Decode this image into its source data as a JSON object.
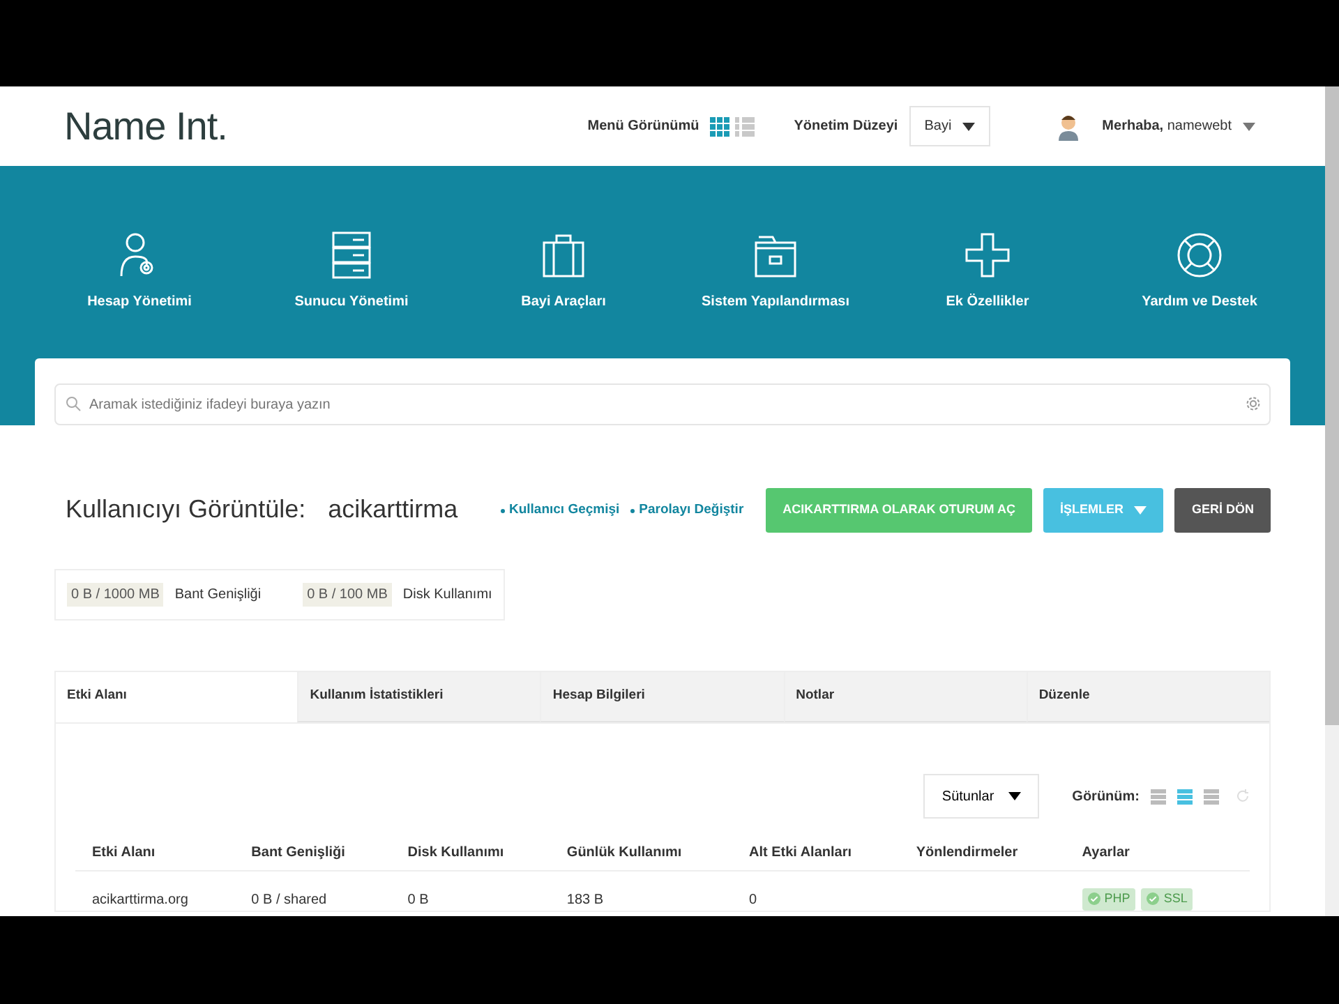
{
  "header": {
    "logo": "Name Int.",
    "menu_view_label": "Menü Görünümü",
    "menu_views": [
      {
        "kind": "grid",
        "selected": true
      },
      {
        "kind": "list",
        "selected": false
      }
    ],
    "level_label": "Yönetim Düzeyi",
    "level_value": "Bayi",
    "greeting": "**Merhaba,** namewebt"
  },
  "nav": [
    {
      "kind": "users",
      "label": "Hesap Yönetimi"
    },
    {
      "kind": "server",
      "label": "Sunucu Yönetimi"
    },
    {
      "kind": "briefcase",
      "label": "Bayi Araçları"
    },
    {
      "kind": "folder",
      "label": "Sistem Yapılandırması"
    },
    {
      "kind": "plus",
      "label": "Ek Özellikler"
    },
    {
      "kind": "lifebuoy",
      "label": "Yardım ve Destek"
    }
  ],
  "search": {
    "placeholder": "Aramak istediğiniz ifadeyi buraya yazın"
  },
  "page_title": "Kullanıcıyı Görüntüle:",
  "username": "acikarttirma",
  "links": [
    "Kullanıcı Geçmişi",
    "Parolayı Değiştir"
  ],
  "buttons": [
    {
      "kind": "success",
      "label": "ACIKARTTIRMA OLARAK OTURUM AÇ",
      "dropdown": false
    },
    {
      "kind": "info",
      "label": "İŞLEMLER",
      "dropdown": true
    },
    {
      "kind": "dark",
      "label": "GERİ DÖN",
      "dropdown": false
    }
  ],
  "usage": [
    {
      "value": "0 B / 1000 MB",
      "label": "Bant Genişliği"
    },
    {
      "value": "0 B / 100 MB",
      "label": "Disk Kullanımı"
    }
  ],
  "tabs": [
    {
      "label": "Etki Alanı",
      "selected": true
    },
    {
      "label": "Kullanım İstatistikleri",
      "selected": false
    },
    {
      "label": "Hesap Bilgileri",
      "selected": false
    },
    {
      "label": "Notlar",
      "selected": false
    },
    {
      "label": "Düzenle",
      "selected": false
    }
  ],
  "columns_button": "Sütunlar",
  "view_label": "Görünüm:",
  "view_modes": [
    {
      "selected": false
    },
    {
      "selected": true
    },
    {
      "selected": false
    }
  ],
  "table": {
    "columns": [
      "Etki Alanı",
      "Bant Genişliği",
      "Disk Kullanımı",
      "Günlük Kullanımı",
      "Alt Etki Alanları",
      "Yönlendirmeler",
      "Ayarlar"
    ],
    "rows": [
      {
        "cells": [
          "acikarttirma.org",
          "0 B / shared",
          "0 B",
          "183 B",
          "0",
          ""
        ],
        "settings": [
          "PHP",
          "SSL"
        ]
      }
    ]
  }
}
